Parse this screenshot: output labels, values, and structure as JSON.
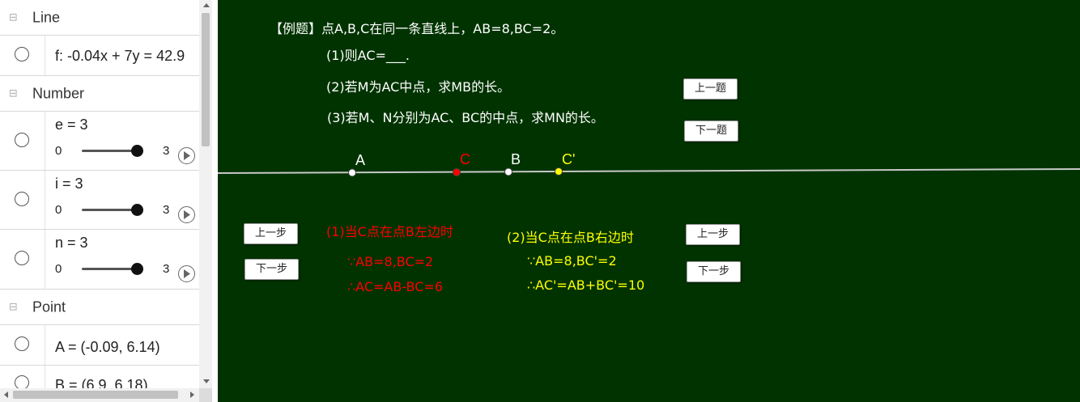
{
  "algebra": {
    "groups": {
      "line": "Line",
      "number": "Number",
      "point": "Point"
    },
    "line_f": "f: -0.04x + 7y = 42.9",
    "numbers": [
      {
        "label": "e = 3",
        "min": "0",
        "max": "3",
        "value": 3
      },
      {
        "label": "i = 3",
        "min": "0",
        "max": "3",
        "value": 3
      },
      {
        "label": "n = 3",
        "min": "0",
        "max": "3",
        "value": 3
      }
    ],
    "points": [
      "A = (-0.09, 6.14)",
      "B = (6.9, 6.18)"
    ]
  },
  "board": {
    "problem": "【例题】点A,B,C在同一条直线上，AB=8,BC=2。",
    "q1": "(1)则AC=___.",
    "q2": "(2)若M为AC中点，求MB的长。",
    "q3": "(3)若M、N分别为AC、BC的中点，求MN的长。",
    "btn_prev_problem": "上一题",
    "btn_next_problem": "下一题",
    "btn_prev_step_left": "上一步",
    "btn_next_step_left": "下一步",
    "btn_prev_step_right": "上一步",
    "btn_next_step_right": "下一步",
    "point_labels": {
      "A": "A",
      "C": "C",
      "B": "B",
      "C2": "C'"
    },
    "case1": {
      "title": "(1)当C点在点B左边时",
      "line1": "∵AB=8,BC=2",
      "line2": "∴AC=AB-BC=6"
    },
    "case2": {
      "title": "(2)当C点在点B右边时",
      "line1": "∵AB=8,BC'=2",
      "line2": "∴AC'=AB+BC'=10"
    }
  },
  "colors": {
    "board_bg": "#003300",
    "text_white": "#ffffff",
    "text_red": "#ff0000",
    "text_yellow": "#ffff00",
    "line": "#c8c8c8"
  }
}
